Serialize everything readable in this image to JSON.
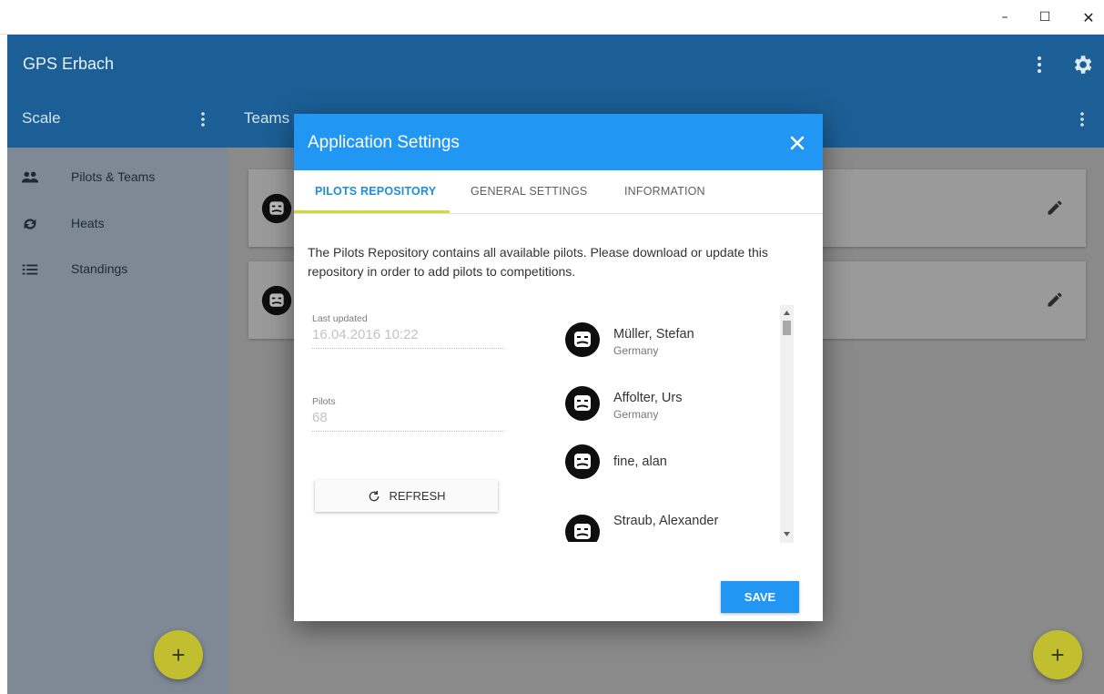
{
  "window": {
    "minimize_glyph": "–",
    "maximize_glyph": "☐",
    "close_glyph": "✕"
  },
  "app": {
    "title": "GPS Erbach",
    "left_panel_title": "Scale",
    "right_panel_title": "Teams"
  },
  "sidebar": {
    "items": [
      {
        "label": "Pilots & Teams",
        "icon": "people-icon"
      },
      {
        "label": "Heats",
        "icon": "refresh-icon"
      },
      {
        "label": "Standings",
        "icon": "list-icon"
      }
    ]
  },
  "fab": {
    "glyph": "+"
  },
  "dialog": {
    "title": "Application Settings",
    "tabs": [
      "PILOTS REPOSITORY",
      "GENERAL SETTINGS",
      "INFORMATION"
    ],
    "active_tab": 0,
    "description": "The Pilots Repository contains all available pilots. Please download or update this repository in order to add pilots to competitions.",
    "last_updated": {
      "label": "Last updated",
      "value": "16.04.2016 10:22"
    },
    "pilots_count": {
      "label": "Pilots",
      "value": "68"
    },
    "refresh_label": "REFRESH",
    "pilots": [
      {
        "name": "Müller, Stefan",
        "country": "Germany"
      },
      {
        "name": "Affolter, Urs",
        "country": "Germany"
      },
      {
        "name": "fine, alan",
        "country": ""
      },
      {
        "name": "Straub, Alexander",
        "country": ""
      }
    ],
    "save_label": "SAVE"
  },
  "colors": {
    "appbar": "#1b5f96",
    "dialog_header": "#2196f3",
    "tab_indicator": "#cddc39",
    "fab": "#c1bf2f"
  }
}
